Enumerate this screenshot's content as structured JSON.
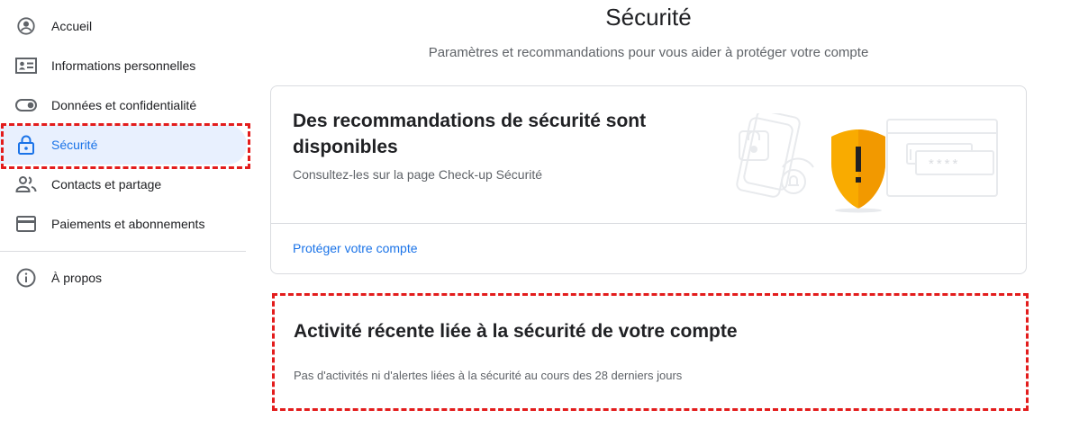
{
  "sidebar": {
    "items": [
      {
        "label": "Accueil",
        "icon": "account-circle-icon"
      },
      {
        "label": "Informations personnelles",
        "icon": "id-card-icon"
      },
      {
        "label": "Données et confidentialité",
        "icon": "toggle-icon"
      },
      {
        "label": "Sécurité",
        "icon": "lock-icon",
        "active": true
      },
      {
        "label": "Contacts et partage",
        "icon": "people-icon"
      },
      {
        "label": "Paiements et abonnements",
        "icon": "credit-card-icon"
      }
    ],
    "about": {
      "label": "À propos",
      "icon": "info-icon"
    }
  },
  "header": {
    "title": "Sécurité",
    "subtitle": "Paramètres et recommandations pour vous aider à protéger votre compte"
  },
  "recommendations_card": {
    "title": "Des recommandations de sécurité sont disponibles",
    "description": "Consultez-les sur la page Check-up Sécurité",
    "link": "Protéger votre compte",
    "illustration_password_mask": "****"
  },
  "activity_card": {
    "title": "Activité récente liée à la sécurité de votre compte",
    "description": "Pas d'activités ni d'alertes liées à la sécurité au cours des 28 derniers jours"
  },
  "colors": {
    "accent": "#1a73e8",
    "active_bg": "#e8f0fe",
    "highlight": "#e31c1c",
    "shield": "#f9ab00"
  }
}
